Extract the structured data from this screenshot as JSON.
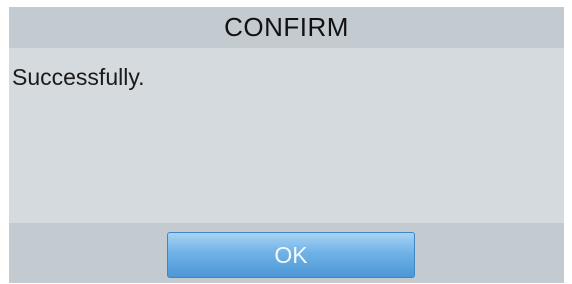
{
  "dialog": {
    "title": "CONFIRM",
    "message": "Successfully.",
    "ok_label": "OK"
  },
  "colors": {
    "title_bar": "#c3cad0",
    "body": "#d4dade",
    "button_top": "#a8d3f4",
    "button_bottom": "#4c97d6"
  }
}
